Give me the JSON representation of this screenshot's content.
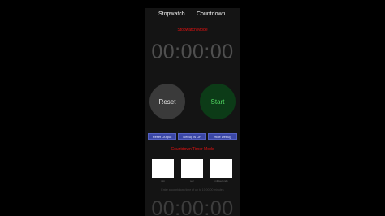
{
  "tabs": {
    "stopwatch": "Stopwatch",
    "countdown": "Countdown"
  },
  "stopwatch": {
    "mode_title": "Stopwatch Mode",
    "time": "00:00:00",
    "reset_label": "Reset",
    "start_label": "Start"
  },
  "debug_buttons": {
    "reset_output": "Reset Output",
    "debug_status": "Debug is On",
    "hide_debug": "Hide Debug"
  },
  "countdown": {
    "mode_title": "Countdown Timer Mode",
    "inputs": [
      {
        "label": "min",
        "value": ""
      },
      {
        "label": "sec",
        "value": ""
      },
      {
        "label": "milliseconds",
        "value": ""
      }
    ],
    "hint": "Enter a countdown time of up to 10:00:00 minutes",
    "time": "00:00:00"
  },
  "colors": {
    "mode_title": "#e31212",
    "start_button_bg": "#0c3b17",
    "start_button_text": "#4fd35f",
    "debug_button_bg": "#3b47a6"
  }
}
